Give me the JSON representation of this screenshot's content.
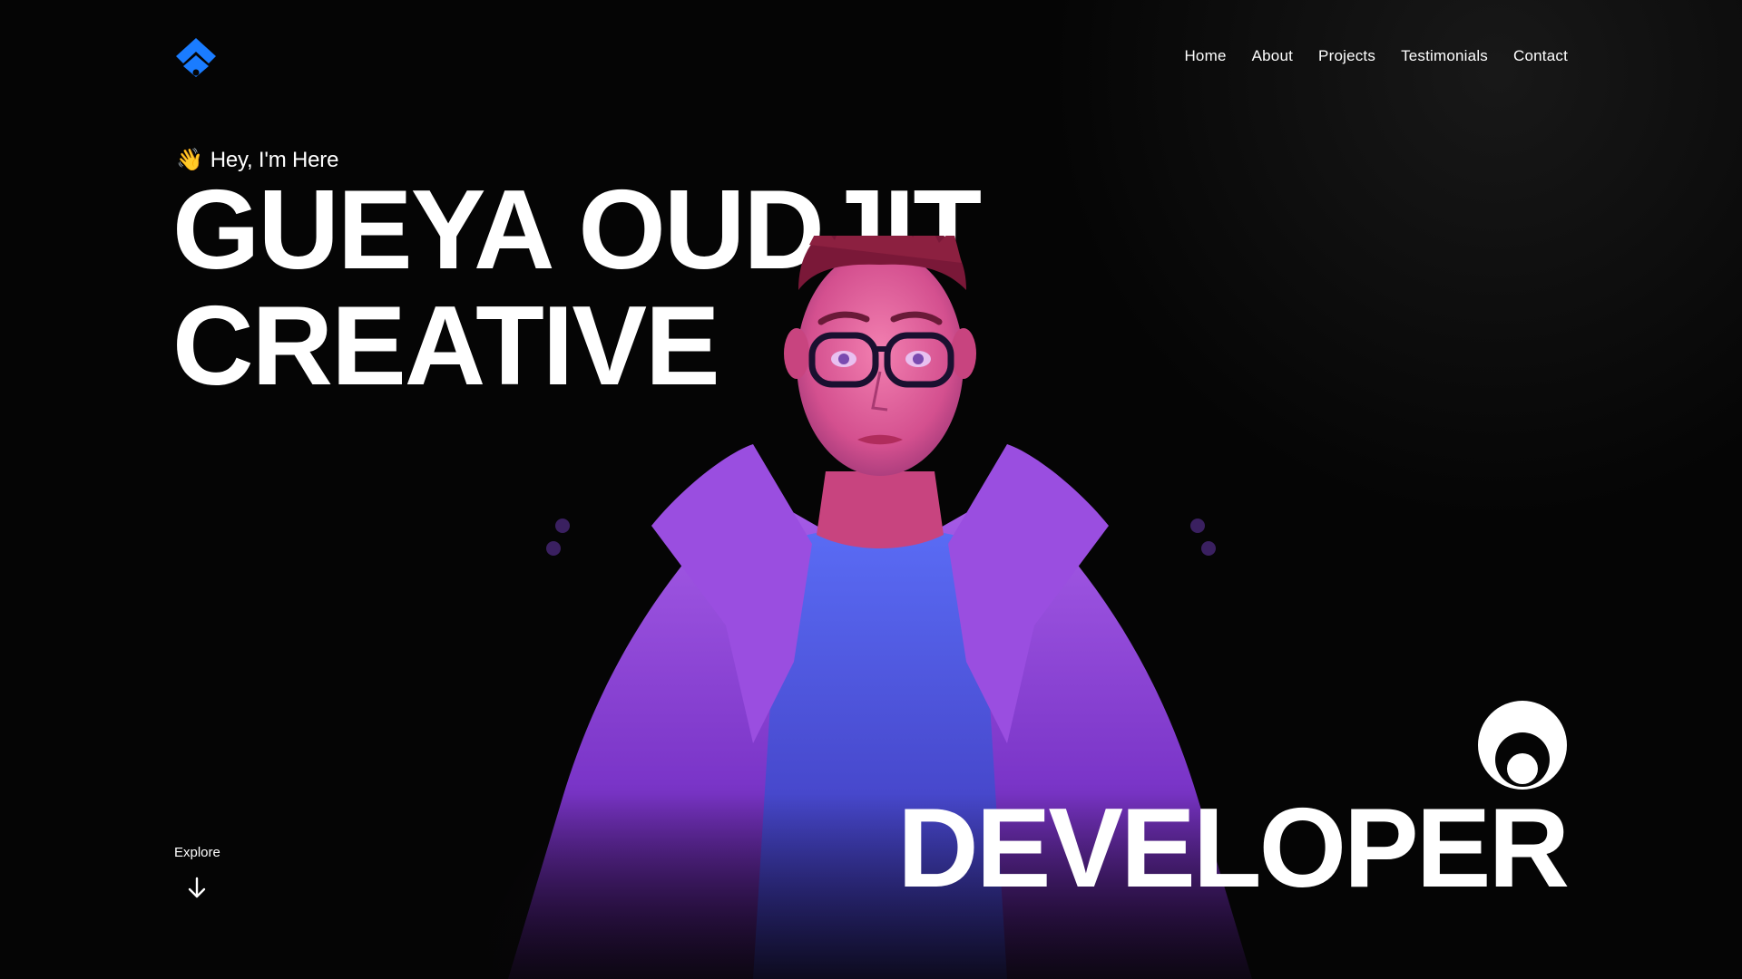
{
  "header": {
    "logo_icon": "diamond-chevron-logo-icon",
    "nav": [
      {
        "label": "Home"
      },
      {
        "label": "About"
      },
      {
        "label": "Projects"
      },
      {
        "label": "Testimonials"
      },
      {
        "label": "Contact"
      }
    ]
  },
  "hero": {
    "greeting_emoji": "👋",
    "greeting": "Hey, I'm Here",
    "headline_line1": "GUEYA OUDJIT",
    "headline_line2": "CREATIVE",
    "role": "DEVELOPER",
    "badge_icon": "circle-ring-icon",
    "avatar_icon": "3d-avatar-illustration"
  },
  "explore": {
    "label": "Explore",
    "icon": "arrow-down-icon"
  },
  "colors": {
    "background": "#050505",
    "accent": "#1a7cff",
    "text": "#ffffff",
    "jacket": "#8a3fd0",
    "shirt": "#4a5ff0"
  }
}
